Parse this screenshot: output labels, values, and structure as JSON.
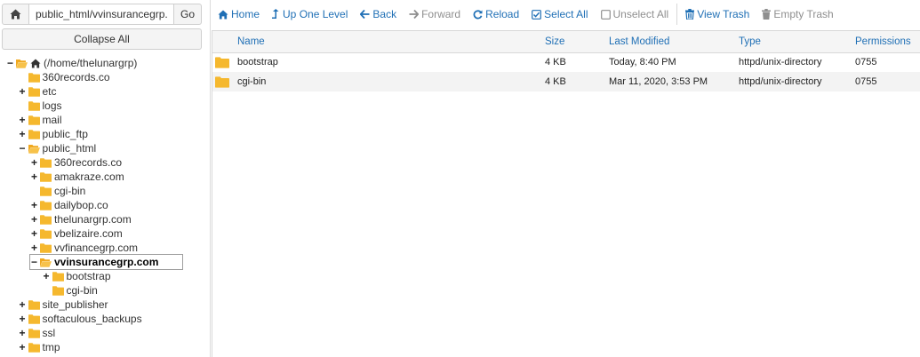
{
  "pathbar": {
    "path_value": "public_html/vvinsurancegrp.co",
    "go_label": "Go",
    "home_icon": "home-icon"
  },
  "collapse_label": "Collapse All",
  "tree": {
    "root_label": "(/home/thelunargrp)",
    "items": [
      {
        "label": "360records.co",
        "toggle": ""
      },
      {
        "label": "etc",
        "toggle": "+"
      },
      {
        "label": "logs",
        "toggle": ""
      },
      {
        "label": "mail",
        "toggle": "+"
      },
      {
        "label": "public_ftp",
        "toggle": "+"
      },
      {
        "label": "public_html",
        "toggle": "−"
      },
      {
        "label": "360records.co",
        "toggle": "+"
      },
      {
        "label": "amakraze.com",
        "toggle": "+"
      },
      {
        "label": "cgi-bin",
        "toggle": ""
      },
      {
        "label": "dailybop.co",
        "toggle": "+"
      },
      {
        "label": "thelunargrp.com",
        "toggle": "+"
      },
      {
        "label": "vbelizaire.com",
        "toggle": "+"
      },
      {
        "label": "vvfinancegrp.com",
        "toggle": "+"
      },
      {
        "label": "vvinsurancegrp.com",
        "toggle": "−"
      },
      {
        "label": "bootstrap",
        "toggle": "+"
      },
      {
        "label": "cgi-bin",
        "toggle": ""
      },
      {
        "label": "site_publisher",
        "toggle": "+"
      },
      {
        "label": "softaculous_backups",
        "toggle": "+"
      },
      {
        "label": "ssl",
        "toggle": "+"
      },
      {
        "label": "tmp",
        "toggle": "+"
      }
    ]
  },
  "toolbar": {
    "home": "Home",
    "up_one_level": "Up One Level",
    "back": "Back",
    "forward": "Forward",
    "reload": "Reload",
    "select_all": "Select All",
    "unselect_all": "Unselect All",
    "view_trash": "View Trash",
    "empty_trash": "Empty Trash"
  },
  "colors": {
    "link_blue": "#1f6fb5",
    "folder_yellow": "#f5b82e",
    "disabled_gray": "#8f8f8f"
  },
  "table": {
    "headers": {
      "name": "Name",
      "size": "Size",
      "last_modified": "Last Modified",
      "type": "Type",
      "permissions": "Permissions"
    },
    "rows": [
      {
        "name": "bootstrap",
        "size": "4 KB",
        "modified": "Today, 8:40 PM",
        "type": "httpd/unix-directory",
        "perms": "0755"
      },
      {
        "name": "cgi-bin",
        "size": "4 KB",
        "modified": "Mar 11, 2020, 3:53 PM",
        "type": "httpd/unix-directory",
        "perms": "0755"
      }
    ]
  }
}
